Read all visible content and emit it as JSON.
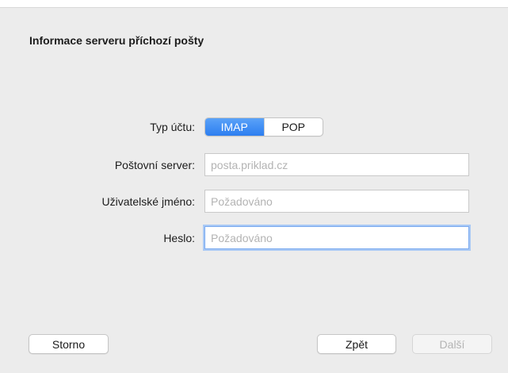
{
  "dialog": {
    "heading": "Informace serveru příchozí pošty"
  },
  "form": {
    "account_type": {
      "label": "Typ účtu:",
      "options": [
        "IMAP",
        "POP"
      ],
      "selected": "IMAP"
    },
    "mail_server": {
      "label": "Poštovní server:",
      "value": "",
      "placeholder": "posta.priklad.cz"
    },
    "username": {
      "label": "Uživatelské jméno:",
      "value": "",
      "placeholder": "Požadováno"
    },
    "password": {
      "label": "Heslo:",
      "value": "",
      "placeholder": "Požadováno"
    }
  },
  "buttons": {
    "cancel": "Storno",
    "back": "Zpět",
    "next": "Další"
  },
  "colors": {
    "background": "#ececec",
    "accent": "#3b88f3",
    "focus_ring": "#a9c9f5",
    "placeholder": "#b3b3b3"
  }
}
